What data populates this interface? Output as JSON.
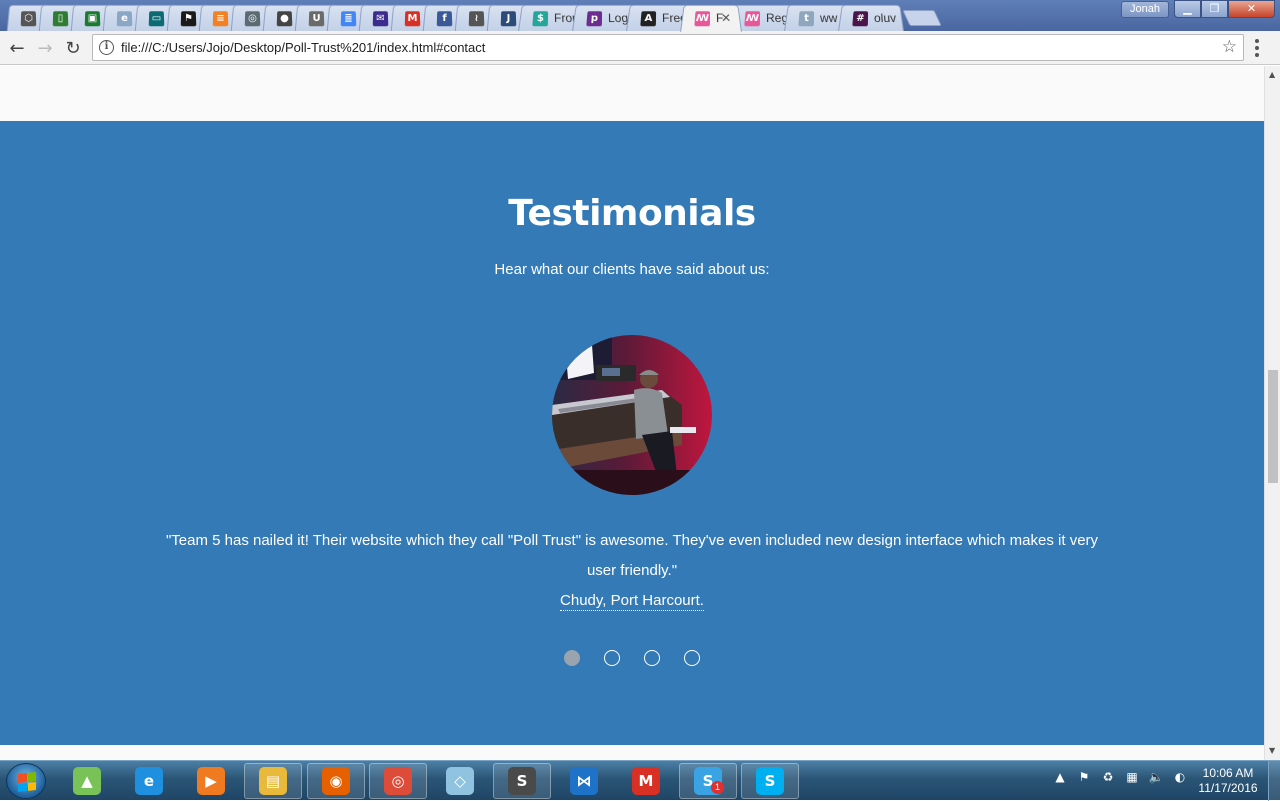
{
  "browser": {
    "tabs": [
      {
        "icon": "codepen-icon",
        "label": "",
        "color": "#555555",
        "glyph": "⬡"
      },
      {
        "icon": "document-icon",
        "label": "",
        "color": "#2e7d32",
        "glyph": "▯"
      },
      {
        "icon": "spreadsheet-icon",
        "label": "",
        "color": "#1b7a2f",
        "glyph": "▣"
      },
      {
        "icon": "edx-icon",
        "label": "",
        "color": "#8aa7c6",
        "glyph": "e"
      },
      {
        "icon": "slides-icon",
        "label": "",
        "color": "#0b6a73",
        "glyph": "▭"
      },
      {
        "icon": "flag-icon",
        "label": "",
        "color": "#1a1a1a",
        "glyph": "⚑"
      },
      {
        "icon": "stackoverflow-icon",
        "label": "",
        "color": "#f48024",
        "glyph": "≡"
      },
      {
        "icon": "spiral-icon",
        "label": "",
        "color": "#5c6b73",
        "glyph": "◎"
      },
      {
        "icon": "github-icon",
        "label": "",
        "color": "#444444",
        "glyph": "●"
      },
      {
        "icon": "udacity-icon",
        "label": "",
        "color": "#6a6a6a",
        "glyph": "U"
      },
      {
        "icon": "google-docs-icon",
        "label": "",
        "color": "#4285f4",
        "glyph": "≣"
      },
      {
        "icon": "mail-icon",
        "label": "",
        "color": "#3c2a8c",
        "glyph": "✉"
      },
      {
        "icon": "gmail-icon",
        "label": "",
        "color": "#d93025",
        "glyph": "M"
      },
      {
        "icon": "facebook-icon",
        "label": "",
        "color": "#3b5998",
        "glyph": "f"
      },
      {
        "icon": "waveform-icon",
        "label": "",
        "color": "#555555",
        "glyph": "≀"
      },
      {
        "icon": "j-icon",
        "label": "",
        "color": "#2c4a7a",
        "glyph": "J"
      },
      {
        "icon": "dollar-icon",
        "label": "Fron",
        "color": "#26a69a",
        "glyph": "$"
      },
      {
        "icon": "p-icon",
        "label": "Logi",
        "color": "#6d2c8f",
        "glyph": "p"
      },
      {
        "icon": "az-icon",
        "label": "Free",
        "color": "#222222",
        "glyph": "A"
      },
      {
        "icon": "pollen-icon",
        "label": "F",
        "color": "#e9579b",
        "glyph": "ꟿ",
        "active": true
      },
      {
        "icon": "pollen-icon",
        "label": "Reg",
        "color": "#e9579b",
        "glyph": "ꟿ"
      },
      {
        "icon": "twitter-icon",
        "label": "ww",
        "color": "#8fa7bd",
        "glyph": "t"
      },
      {
        "icon": "slack-icon",
        "label": "oluv",
        "color": "#4a154b",
        "glyph": "#"
      }
    ],
    "profile_name": "Jonah",
    "url": "file:///C:/Users/Jojo/Desktop/Poll-Trust%201/index.html#contact"
  },
  "page": {
    "section_title": "Testimonials",
    "section_subtitle": "Hear what our clients have said about us:",
    "quote": "\"Team 5 has nailed it! Their website which they call \"Poll Trust\" is awesome. They've even included new design interface which makes it very user friendly.\"",
    "author": "Chudy, Port Harcourt.",
    "slides": [
      {
        "active": true
      },
      {
        "active": false
      },
      {
        "active": false
      },
      {
        "active": false
      }
    ],
    "colors": {
      "section_bg": "#337ab7",
      "active_dot": "#9aa4ae"
    }
  },
  "taskbar": {
    "apps": [
      {
        "icon": "android-studio-icon",
        "color": "#78c257",
        "glyph": "▲",
        "pinned": false
      },
      {
        "icon": "internet-explorer-icon",
        "color": "#1f8fe0",
        "glyph": "e",
        "pinned": false
      },
      {
        "icon": "media-player-icon",
        "color": "#f07a20",
        "glyph": "▶",
        "pinned": false
      },
      {
        "icon": "file-explorer-icon",
        "color": "#e8b93a",
        "glyph": "▤",
        "pinned": true
      },
      {
        "icon": "firefox-icon",
        "color": "#e66000",
        "glyph": "◉",
        "pinned": true
      },
      {
        "icon": "chrome-icon",
        "color": "#dd4b39",
        "glyph": "◎",
        "pinned": true
      },
      {
        "icon": "notes-icon",
        "color": "#8fc3e0",
        "glyph": "◇",
        "pinned": false
      },
      {
        "icon": "sublime-text-icon",
        "color": "#4a4a4a",
        "glyph": "S",
        "pinned": true
      },
      {
        "icon": "visual-studio-code-icon",
        "color": "#1e73c8",
        "glyph": "⋈",
        "pinned": false
      },
      {
        "icon": "gmail-icon",
        "color": "#d93025",
        "glyph": "M",
        "pinned": false
      },
      {
        "icon": "slack-icon",
        "color": "#3aa3e3",
        "glyph": "S",
        "pinned": true,
        "badge": "1"
      },
      {
        "icon": "skype-icon",
        "color": "#00aff0",
        "glyph": "S",
        "pinned": true
      }
    ],
    "time": "10:06 AM",
    "date": "11/17/2016"
  }
}
